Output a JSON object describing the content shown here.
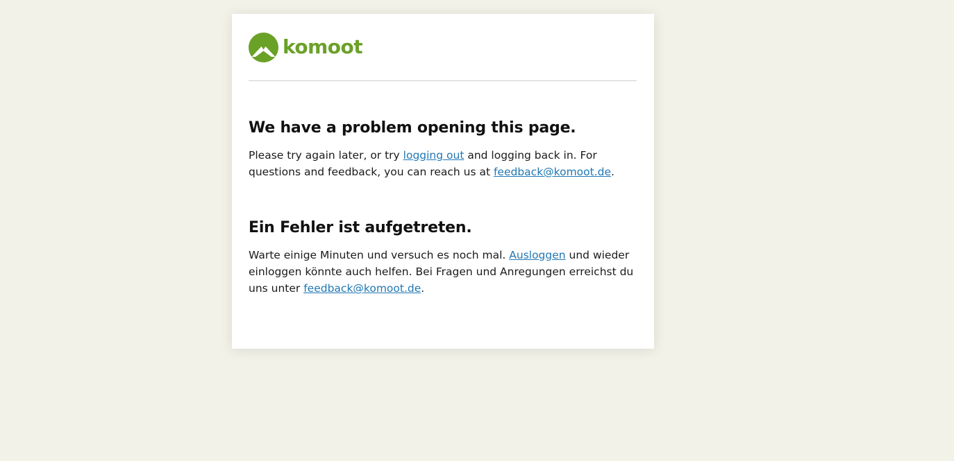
{
  "brand": {
    "name": "komoot",
    "logo_icon": "mountain-peak-icon",
    "color": "#6aa127"
  },
  "english": {
    "heading": "We have a problem opening this page.",
    "text_1": "Please try again later, or try ",
    "logout_link": "logging out",
    "text_2": " and logging back in. For questions and feedback, you can reach us at ",
    "email_link": "feedback@komoot.de",
    "text_3": "."
  },
  "german": {
    "heading": "Ein Fehler ist aufgetreten.",
    "text_1": "Warte einige Minuten und versuch es noch mal. ",
    "logout_link": "Ausloggen",
    "text_2": " und wieder einloggen könnte auch helfen. Bei Fragen und Anregungen erreichst du uns unter ",
    "email_link": "feedback@komoot.de",
    "text_3": "."
  },
  "colors": {
    "background": "#f2f2e8",
    "card": "#ffffff",
    "link": "#1f77b4"
  }
}
